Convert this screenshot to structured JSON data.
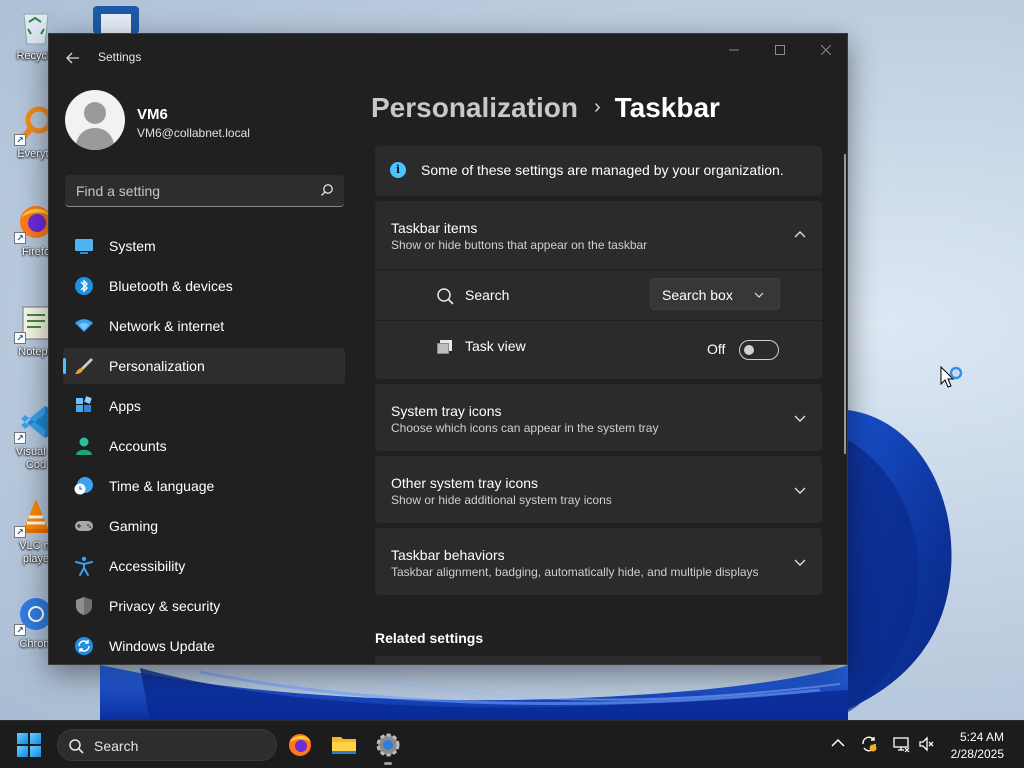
{
  "desktop": {
    "icons": [
      {
        "label": "Recycle",
        "icon": "recycle-bin-icon"
      },
      {
        "label": "Everyth",
        "icon": "everything-search-icon"
      },
      {
        "label": "Firefo",
        "icon": "firefox-icon"
      },
      {
        "label": "Notepa",
        "icon": "notepad-icon"
      },
      {
        "label": "Visual S",
        "label2": "Cod",
        "icon": "vscode-icon"
      },
      {
        "label": "VLC m",
        "label2": "playe",
        "icon": "vlc-icon"
      },
      {
        "label": "Chrom",
        "icon": "chrome-icon"
      }
    ]
  },
  "window": {
    "title": "Settings",
    "back_icon": "back-arrow-icon",
    "controls": [
      "minimize-icon",
      "maximize-icon",
      "close-icon"
    ]
  },
  "profile": {
    "name": "VM6",
    "email": "VM6@collabnet.local"
  },
  "search": {
    "placeholder": "Find a setting"
  },
  "nav": {
    "items": [
      {
        "label": "System",
        "icon": "system-icon"
      },
      {
        "label": "Bluetooth & devices",
        "icon": "bluetooth-icon"
      },
      {
        "label": "Network & internet",
        "icon": "network-icon"
      },
      {
        "label": "Personalization",
        "icon": "brush-icon",
        "selected": true
      },
      {
        "label": "Apps",
        "icon": "apps-icon"
      },
      {
        "label": "Accounts",
        "icon": "accounts-icon"
      },
      {
        "label": "Time & language",
        "icon": "time-language-icon"
      },
      {
        "label": "Gaming",
        "icon": "gaming-icon"
      },
      {
        "label": "Accessibility",
        "icon": "accessibility-icon"
      },
      {
        "label": "Privacy & security",
        "icon": "shield-icon"
      },
      {
        "label": "Windows Update",
        "icon": "update-icon"
      }
    ]
  },
  "main": {
    "breadcrumb": {
      "parent": "Personalization",
      "current": "Taskbar"
    },
    "org_notice": "Some of these settings are managed by your organization.",
    "taskbar_items": {
      "title": "Taskbar items",
      "description": "Show or hide buttons that appear on the taskbar",
      "expanded": true,
      "search": {
        "label": "Search",
        "value": "Search box"
      },
      "task_view": {
        "label": "Task view",
        "state": "Off"
      }
    },
    "system_tray_icons": {
      "title": "System tray icons",
      "description": "Choose which icons can appear in the system tray"
    },
    "other_tray_icons": {
      "title": "Other system tray icons",
      "description": "Show or hide additional system tray icons"
    },
    "taskbar_behaviors": {
      "title": "Taskbar behaviors",
      "description": "Taskbar alignment, badging, automatically hide, and multiple displays"
    },
    "related_heading": "Related settings"
  },
  "taskbar": {
    "search_label": "Search",
    "apps": [
      "firefox-icon",
      "file-explorer-icon",
      "settings-gear-icon"
    ],
    "tray": [
      "chevron-up-icon",
      "sync-icon",
      "network-icon",
      "volume-muted-icon"
    ],
    "time": "5:24 AM",
    "date": "2/28/2025"
  },
  "colors": {
    "accent": "#4cc2ff",
    "window_bg": "#202020",
    "card_bg": "#2b2b2b"
  }
}
